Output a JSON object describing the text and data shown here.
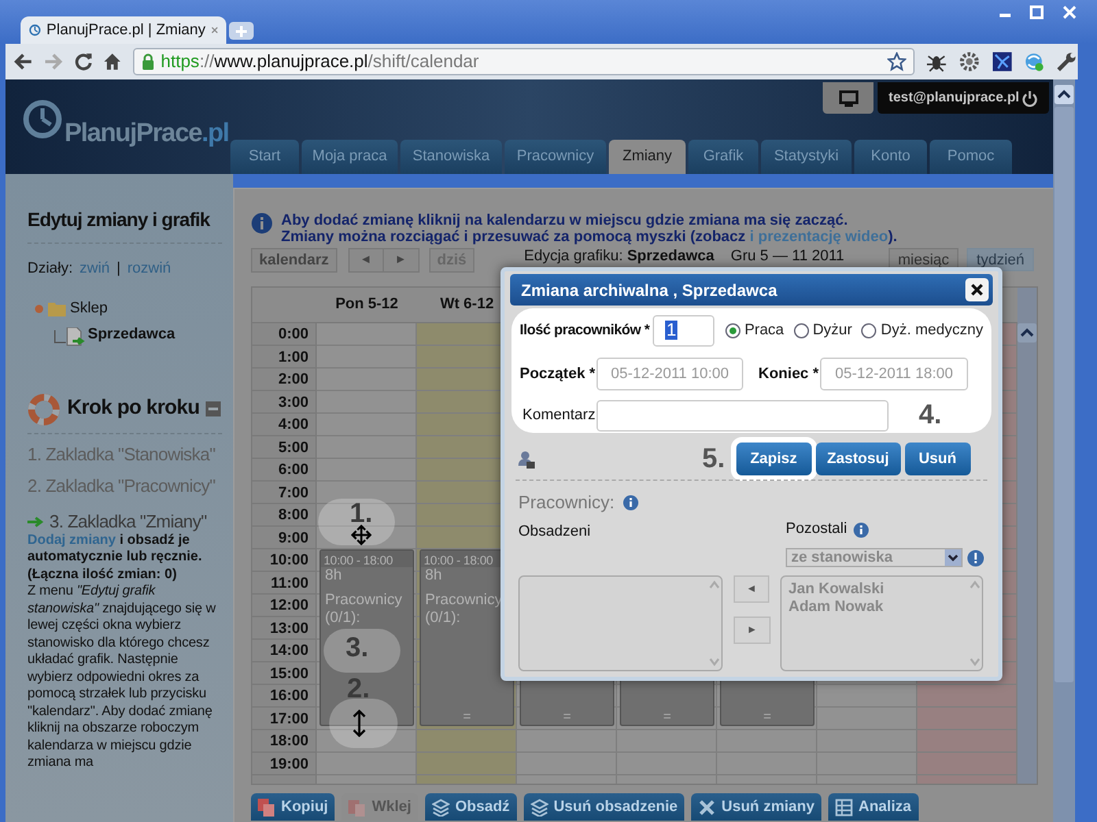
{
  "browser": {
    "tab_title": "PlanujPrace.pl | Zmiany",
    "url_scheme": "https",
    "url_separator": "://",
    "url_host": "www.planujprace.pl",
    "url_path": "/shift/calendar"
  },
  "header": {
    "logo_name": "PlanujPrace",
    "logo_suffix": ".pl",
    "user_email": "test@planujprace.pl",
    "nav": [
      {
        "label": "Start",
        "selected": false
      },
      {
        "label": "Moja praca",
        "selected": false
      },
      {
        "label": "Stanowiska",
        "selected": false
      },
      {
        "label": "Pracownicy",
        "selected": false
      },
      {
        "label": "Zmiany",
        "selected": true
      },
      {
        "label": "Grafik",
        "selected": false
      },
      {
        "label": "Statystyki",
        "selected": false
      },
      {
        "label": "Konto",
        "selected": false
      },
      {
        "label": "Pomoc",
        "selected": false
      }
    ]
  },
  "sidebar": {
    "title": "Edytuj zmiany i grafik",
    "sections_label": "Działy:",
    "collapse_link": "zwiń",
    "divider": "|",
    "expand_link": "rozwiń",
    "tree": [
      {
        "label": "Sklep",
        "children": [
          {
            "label": "Sprzedawca"
          }
        ]
      }
    ],
    "guide_title": "Krok po kroku",
    "steps": [
      {
        "label": "1. Zakladka \"Stanowiska\"",
        "current": false
      },
      {
        "label": "2. Zakladka \"Pracownicy\"",
        "current": false
      },
      {
        "label": "3. Zakladka \"Zmiany\"",
        "current": true
      }
    ],
    "step_link": "Dodaj zmiany",
    "step_summary": "i obsadź je automatycznie lub ręcznie. (Łączna ilość zmian: 0)",
    "step_text": "Z menu *\"Edytuj grafik stanowiska\"* znajdującego się w lewej części okna wybierz stanowisko dla którego chcesz układać grafik. Następnie wybierz odpowiedni okres za pomocą strzałek lub przycisku \"kalendarz\". Aby dodać zmianę kliknij na obszarze roboczym kalendarza w miejscu gdzie zmiana ma"
  },
  "info": {
    "line1": "Aby dodać zmianę kliknij na kalendarzu w miejscu gdzie zmiana ma się zacząć.",
    "line2_before": "Zmiany można rozciągać i przesuwać za pomocą myszki (zobacz ",
    "line2_link": "i prezentację wideo",
    "line2_after": ")."
  },
  "calendar_toolbar": {
    "calendar_button": "kalendarz",
    "prev_button": "◄",
    "next_button": "►",
    "today_button": "dziś",
    "edit_label": "Edycja grafiku:",
    "position": "Sprzedawca",
    "range": "Gru 5 — 11 2011",
    "views": [
      {
        "label": "miesiąc",
        "selected": false
      },
      {
        "label": "tydzień",
        "selected": true
      }
    ]
  },
  "calendar": {
    "hours": [
      "0:00",
      "1:00",
      "2:00",
      "3:00",
      "4:00",
      "5:00",
      "6:00",
      "7:00",
      "8:00",
      "9:00",
      "10:00",
      "11:00",
      "12:00",
      "13:00",
      "14:00",
      "15:00",
      "16:00",
      "17:00",
      "18:00",
      "19:00"
    ],
    "days": [
      {
        "label": "Pon 5-12",
        "today": false,
        "holiday": false,
        "shift": {
          "time": "10:00 - 18:00",
          "hours": "8h",
          "staff": "Pracownicy (0/1):"
        }
      },
      {
        "label": "Wt 6-12",
        "today": true,
        "holiday": false,
        "shift": {
          "time": "10:00 - 18:00",
          "hours": "8h",
          "staff": "Pracownicy (0/1):",
          "handle": "="
        }
      },
      {
        "today": false,
        "holiday": false,
        "shift": {
          "handle": "="
        }
      },
      {
        "today": false,
        "holiday": false,
        "shift": {
          "handle": "="
        }
      },
      {
        "today": false,
        "holiday": false,
        "shift": {
          "handle": "="
        }
      },
      {
        "today": false,
        "holiday": false
      },
      {
        "today": false,
        "holiday": true
      }
    ],
    "markers": [
      "1.",
      "3.",
      "2."
    ]
  },
  "dialog": {
    "title": "Zmiana archiwalna , Sprzedawca",
    "count_label": "Ilość pracowników *",
    "count_value": "1",
    "types": [
      {
        "label": "Praca",
        "selected": true
      },
      {
        "label": "Dyżur",
        "selected": false
      },
      {
        "label": "Dyż. medyczny",
        "selected": false
      }
    ],
    "start_label": "Początek *",
    "start_value": "05-12-2011 10:00",
    "end_label": "Koniec *",
    "end_value": "05-12-2011 18:00",
    "comment_label": "Komentarz",
    "form_marker": "4.",
    "buttons_marker": "5.",
    "buttons": [
      "Zapisz",
      "Zastosuj",
      "Usuń"
    ],
    "workers_label": "Pracownicy:",
    "assigned_label": "Obsadzeni",
    "remaining_label": "Pozostali",
    "source_select": "ze stanowiska",
    "move_left": "◄",
    "move_right": "►",
    "remaining": [
      "Jan Kowalski",
      "Adam Nowak"
    ]
  },
  "actions": [
    {
      "label": "Kopiuj",
      "disabled": false
    },
    {
      "label": "Wklej",
      "disabled": true
    },
    {
      "label": "Obsadź",
      "disabled": false
    },
    {
      "label": "Usuń obsadzenie",
      "disabled": false
    },
    {
      "label": "Usuń zmiany",
      "disabled": false
    },
    {
      "label": "Analiza",
      "disabled": false
    }
  ]
}
